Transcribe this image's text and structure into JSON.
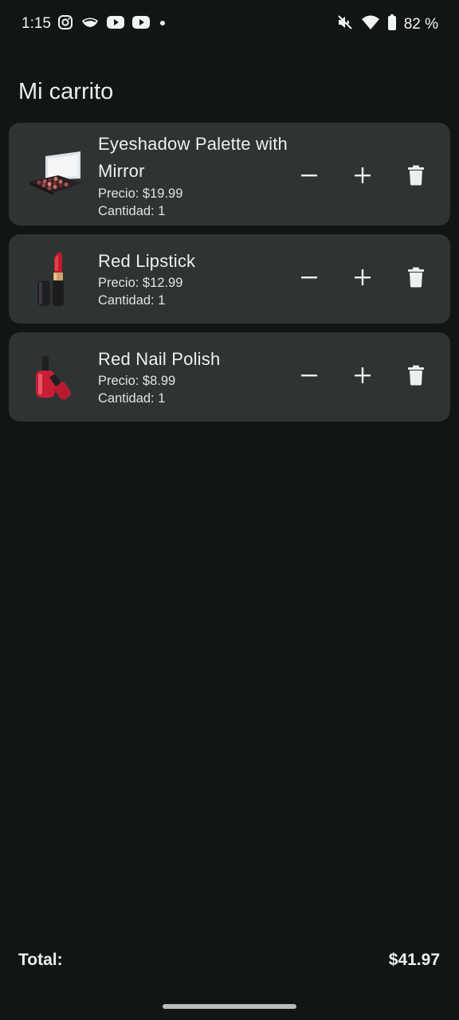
{
  "status_bar": {
    "time": "1:15",
    "left_icons": [
      "instagram-icon",
      "mask-icon",
      "youtube-icon",
      "youtube-icon",
      "dot-icon"
    ],
    "right_icons": [
      "mute-icon",
      "wifi-icon",
      "battery-icon"
    ],
    "battery": "82 %"
  },
  "header": {
    "title": "Mi carrito"
  },
  "cart": {
    "items": [
      {
        "name": "Eyeshadow Palette with Mirror",
        "price": "Precio: $19.99",
        "quantity": "Cantidad: 1"
      },
      {
        "name": "Red Lipstick",
        "price": "Precio: $12.99",
        "quantity": "Cantidad: 1"
      },
      {
        "name": "Red Nail Polish",
        "price": "Precio: $8.99",
        "quantity": "Cantidad: 1"
      }
    ],
    "action_icons": [
      "minus-icon",
      "plus-icon",
      "trash-icon"
    ]
  },
  "footer": {
    "total_label": "Total:",
    "total_value": "$41.97"
  },
  "colors": {
    "background": "#101615",
    "card": "#2e3433",
    "text": "#eef0ef"
  }
}
